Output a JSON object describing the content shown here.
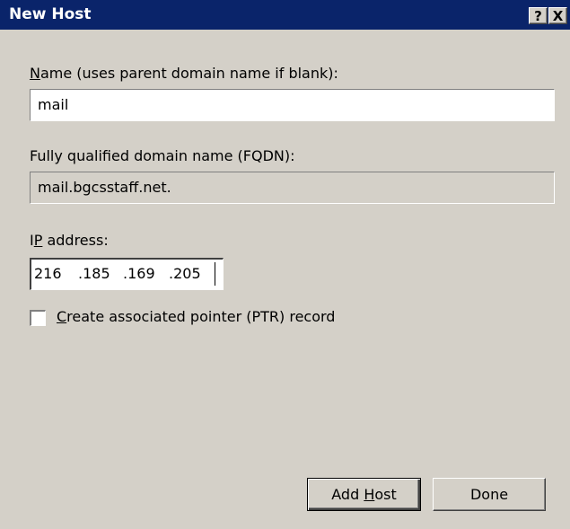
{
  "window": {
    "title": "New Host"
  },
  "title_buttons": {
    "help": "?",
    "close": "X"
  },
  "name_field": {
    "label_accel": "N",
    "label_rest": "ame (uses parent domain name if blank):",
    "value": "mail"
  },
  "fqdn_field": {
    "label": "Fully qualified domain name (FQDN):",
    "value": "mail.bgcsstaff.net."
  },
  "ip_field": {
    "label_pre": "I",
    "label_accel": "P",
    "label_rest": " address:",
    "octets": [
      "216",
      ".185",
      ".169",
      ".205"
    ]
  },
  "ptr_checkbox": {
    "label_accel": "C",
    "label_rest": "reate associated pointer (PTR) record",
    "checked": false
  },
  "buttons": {
    "add_host_pre": "Add ",
    "add_host_accel": "H",
    "add_host_rest": "ost",
    "done": "Done"
  }
}
